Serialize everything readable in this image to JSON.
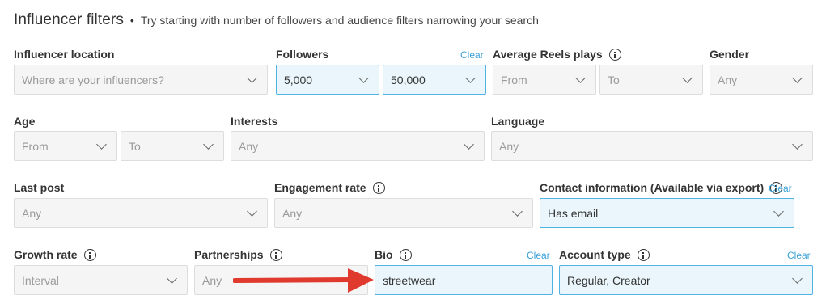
{
  "header": {
    "title": "Influencer filters",
    "separator": "•",
    "subtitle": "Try starting with number of followers and audience filters narrowing your search"
  },
  "filters": {
    "influencer_location": {
      "label": "Influencer location",
      "placeholder": "Where are your influencers?"
    },
    "followers": {
      "label": "Followers",
      "clear": "Clear",
      "from": "5,000",
      "to": "50,000"
    },
    "avg_reels_plays": {
      "label": "Average Reels plays",
      "from": "From",
      "to": "To"
    },
    "gender": {
      "label": "Gender",
      "value": "Any"
    },
    "age": {
      "label": "Age",
      "from": "From",
      "to": "To"
    },
    "interests": {
      "label": "Interests",
      "value": "Any"
    },
    "language": {
      "label": "Language",
      "value": "Any"
    },
    "last_post": {
      "label": "Last post",
      "value": "Any"
    },
    "engagement_rate": {
      "label": "Engagement rate",
      "value": "Any"
    },
    "contact_information": {
      "label": "Contact information (Available via export)",
      "clear": "Clear",
      "value": "Has email"
    },
    "growth_rate": {
      "label": "Growth rate",
      "value": "Interval"
    },
    "partnerships": {
      "label": "Partnerships",
      "value": "Any"
    },
    "bio": {
      "label": "Bio",
      "clear": "Clear",
      "value": "streetwear"
    },
    "account_type": {
      "label": "Account type",
      "clear": "Clear",
      "value": "Regular, Creator"
    }
  },
  "colors": {
    "accent": "#3aa0d8",
    "active_bg": "#eaf6fb",
    "active_border": "#4fb3e4",
    "annotation_arrow": "#e03a2f"
  },
  "icons": [
    "info-icon",
    "chevron-down-icon",
    "red-arrow-annotation"
  ]
}
